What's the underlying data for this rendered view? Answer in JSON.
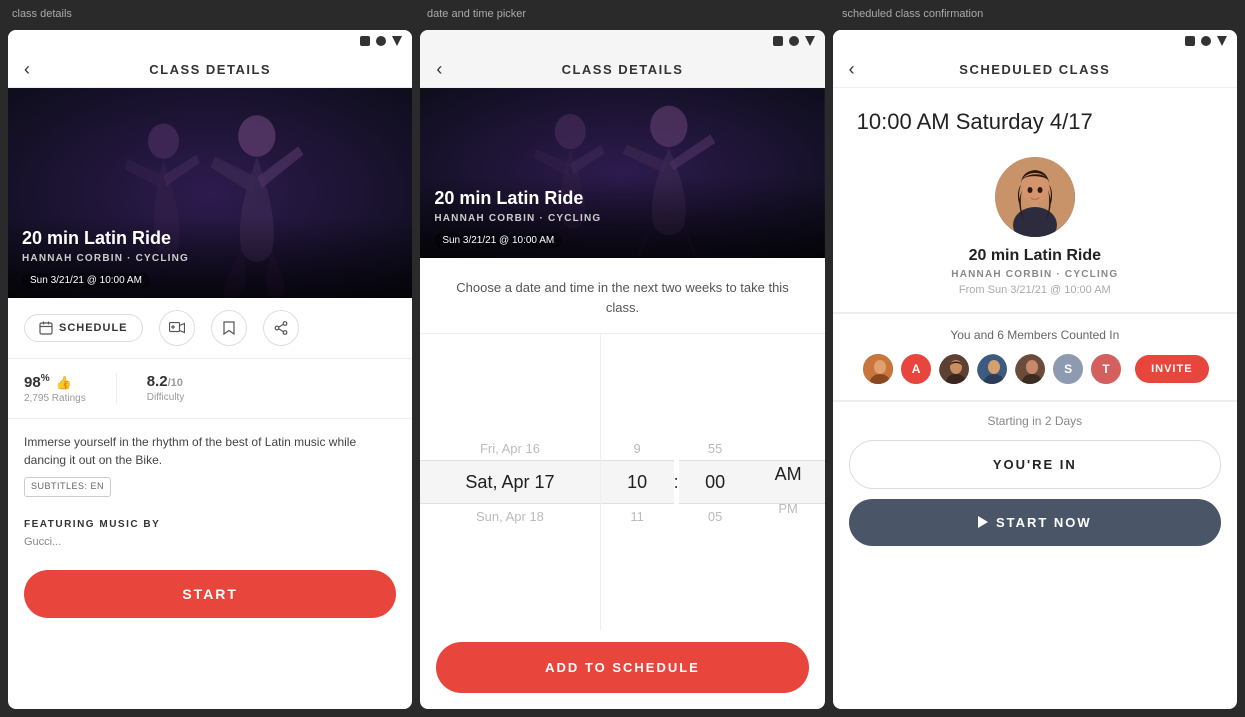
{
  "screen1": {
    "label": "class details",
    "status_icons": [
      "square",
      "dot",
      "triangle"
    ],
    "nav_title": "CLASS DETAILS",
    "back_label": "‹",
    "hero": {
      "title": "20 min Latin Ride",
      "subtitle": "HANNAH CORBIN · CYCLING",
      "date": "Sun 3/21/21 @ 10:00 AM"
    },
    "actions": {
      "schedule_label": "SCHEDULE",
      "icons": [
        "calendar",
        "add-video",
        "bookmark",
        "share"
      ]
    },
    "stats": {
      "rating_value": "98",
      "rating_suffix": "%",
      "rating_count": "2,795 Ratings",
      "difficulty_value": "8.2",
      "difficulty_suffix": "/10",
      "difficulty_label": "Difficulty"
    },
    "description": "Immerse yourself in the rhythm of the best of Latin music while dancing it out on the Bike.",
    "subtitle_badge": "SUBTITLES: EN",
    "music_heading": "FEATURING MUSIC BY",
    "music_items": "Gucci...",
    "start_label": "START"
  },
  "screen2": {
    "label": "date and time picker",
    "status_icons": [
      "square",
      "dot",
      "triangle"
    ],
    "nav_title": "CLASS DETAILS",
    "back_label": "‹",
    "hero": {
      "title": "20 min Latin Ride",
      "subtitle": "HANNAH CORBIN · CYCLING",
      "date": "Sun 3/21/21 @ 10:00 AM"
    },
    "picker_info": "Choose a date and time in the next two weeks to take this class.",
    "picker": {
      "dates": [
        "Fri, Apr 16",
        "Sat, Apr 17",
        "Sun, Apr 18"
      ],
      "hours": [
        "9",
        "10",
        "11"
      ],
      "minutes": [
        "55",
        "00",
        "05"
      ],
      "periods": [
        "",
        "AM",
        "PM"
      ]
    },
    "add_to_schedule_label": "ADD TO SCHEDULE"
  },
  "screen3": {
    "label": "scheduled class confirmation",
    "status_icons": [
      "square",
      "dot",
      "triangle"
    ],
    "nav_title": "SCHEDULED CLASS",
    "back_label": "‹",
    "datetime": "10:00 AM Saturday 4/17",
    "class_title": "20 min Latin Ride",
    "class_sub": "HANNAH CORBIN · CYCLING",
    "class_from": "From Sun 3/21/21 @ 10:00 AM",
    "members_label": "You and 6 Members Counted In",
    "members": [
      {
        "type": "photo",
        "color": "#c9763d",
        "initial": ""
      },
      {
        "type": "placeholder",
        "color": "#e8453c",
        "initial": "A"
      },
      {
        "type": "photo",
        "color": "#5c4033",
        "initial": ""
      },
      {
        "type": "photo",
        "color": "#3d5a80",
        "initial": ""
      },
      {
        "type": "photo",
        "color": "#6b4c3b",
        "initial": ""
      },
      {
        "type": "placeholder",
        "color": "#8e9aaf",
        "initial": "S"
      },
      {
        "type": "placeholder",
        "color": "#d45f5f",
        "initial": "T"
      }
    ],
    "invite_label": "INVITE",
    "starting_label": "Starting in 2 Days",
    "youre_in_label": "YOU'RE IN",
    "start_now_label": "START NOW"
  }
}
